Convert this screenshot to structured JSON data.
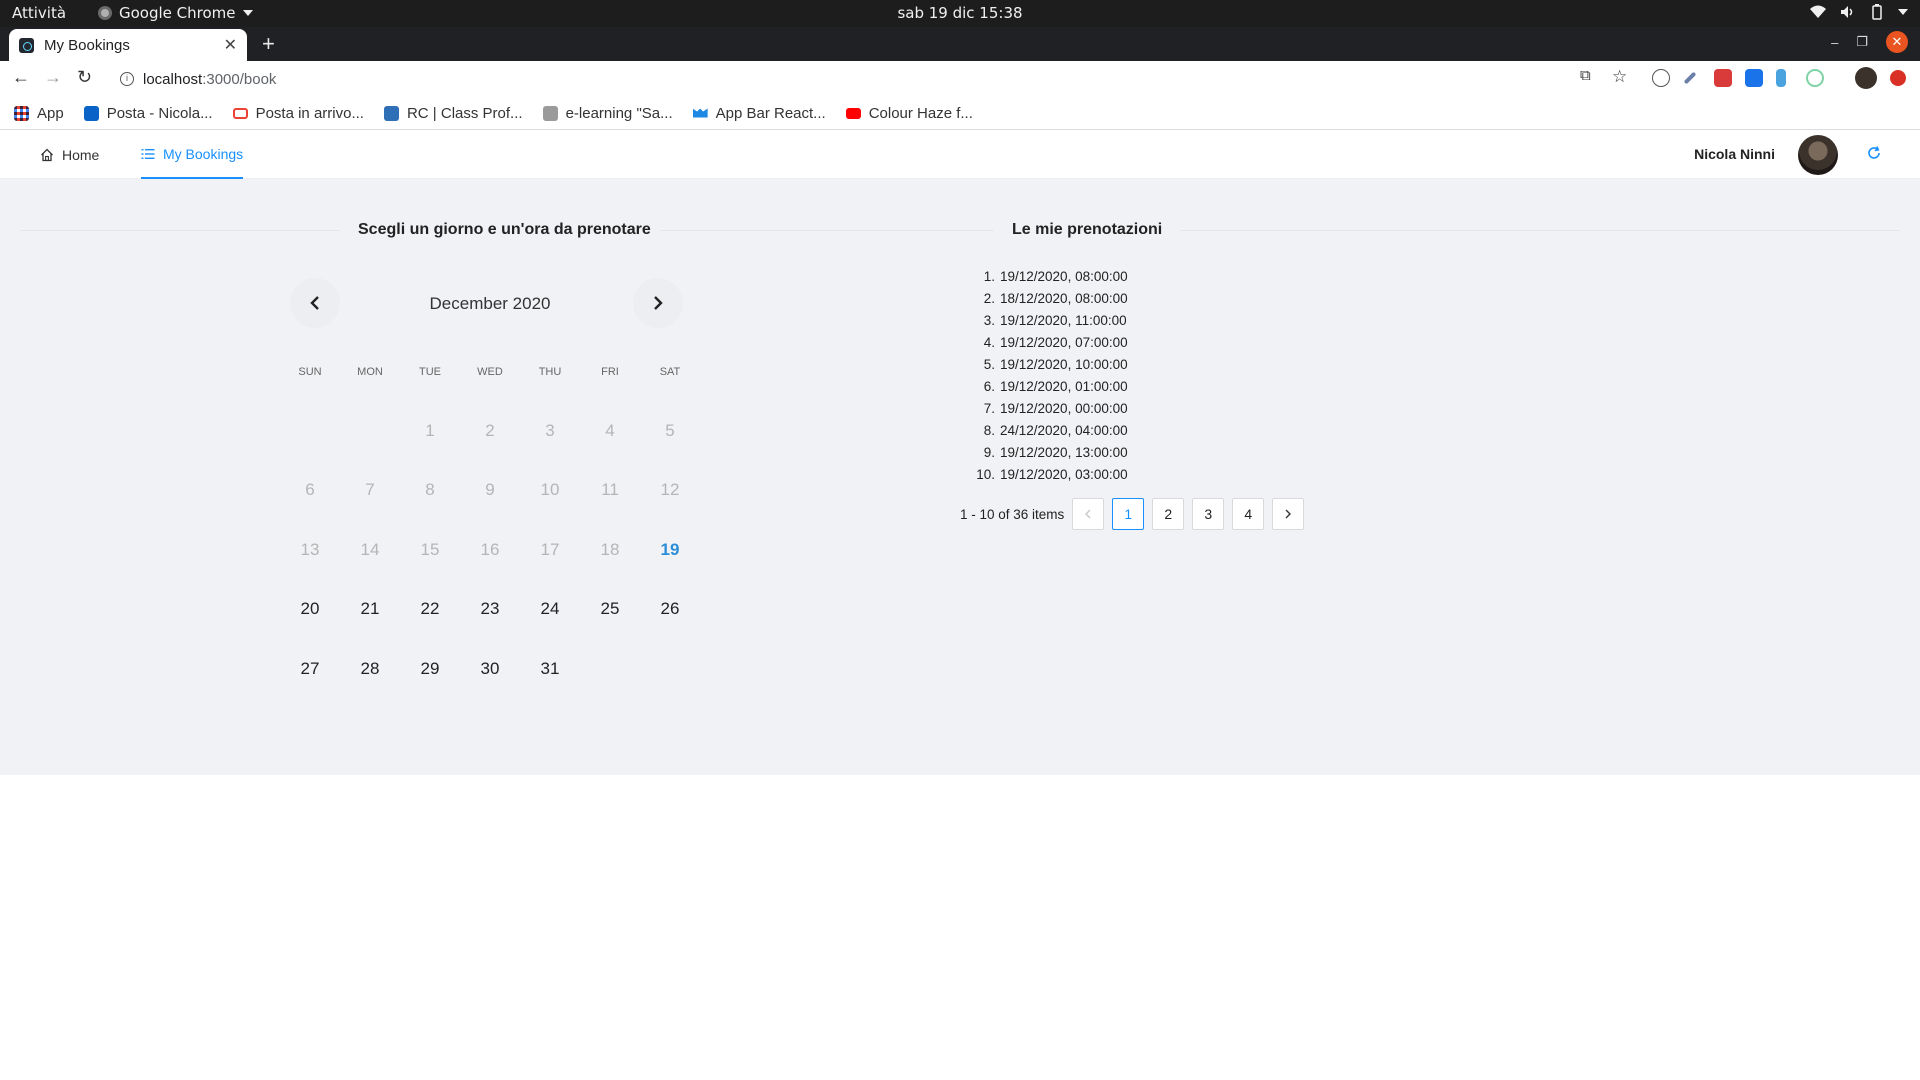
{
  "os": {
    "activities": "Attività",
    "app_name": "Google Chrome",
    "clock": "sab 19 dic  15:38"
  },
  "browser": {
    "tab_title": "My Bookings",
    "url_host": "localhost",
    "url_path": ":3000/book",
    "bookmarks": [
      {
        "label": "App",
        "icon": "apps-grid-icon",
        "color": "#4285f4"
      },
      {
        "label": "Posta - Nicola...",
        "icon": "outlook-icon",
        "color": "#0a64c8"
      },
      {
        "label": "Posta in arrivo...",
        "icon": "gmail-icon",
        "color": "#ea4335"
      },
      {
        "label": "RC | Class Prof...",
        "icon": "p-icon",
        "color": "#2f6fb5"
      },
      {
        "label": "e-learning \"Sa...",
        "icon": "school-icon",
        "color": "#8a8a8a"
      },
      {
        "label": "App Bar React...",
        "icon": "mui-icon",
        "color": "#1e88e5"
      },
      {
        "label": "Colour Haze f...",
        "icon": "youtube-icon",
        "color": "#ff0000"
      }
    ]
  },
  "nav": {
    "items": [
      {
        "label": "Home",
        "icon": "home-icon",
        "active": false
      },
      {
        "label": "My Bookings",
        "icon": "list-icon",
        "active": true
      }
    ],
    "user_name": "Nicola Ninni",
    "accent": "#1890ff"
  },
  "calendar": {
    "section_title": "Scegli un giorno e un'ora da prenotare",
    "month": "December 2020",
    "weekdays": [
      "SUN",
      "MON",
      "TUE",
      "WED",
      "THU",
      "FRI",
      "SAT"
    ],
    "leading_blanks": 2,
    "days": [
      {
        "n": "1",
        "state": "disabled"
      },
      {
        "n": "2",
        "state": "disabled"
      },
      {
        "n": "3",
        "state": "disabled"
      },
      {
        "n": "4",
        "state": "disabled"
      },
      {
        "n": "5",
        "state": "disabled"
      },
      {
        "n": "6",
        "state": "disabled"
      },
      {
        "n": "7",
        "state": "disabled"
      },
      {
        "n": "8",
        "state": "disabled"
      },
      {
        "n": "9",
        "state": "disabled"
      },
      {
        "n": "10",
        "state": "disabled"
      },
      {
        "n": "11",
        "state": "disabled"
      },
      {
        "n": "12",
        "state": "disabled"
      },
      {
        "n": "13",
        "state": "disabled"
      },
      {
        "n": "14",
        "state": "disabled"
      },
      {
        "n": "15",
        "state": "disabled"
      },
      {
        "n": "16",
        "state": "disabled"
      },
      {
        "n": "17",
        "state": "disabled"
      },
      {
        "n": "18",
        "state": "disabled"
      },
      {
        "n": "19",
        "state": "today"
      },
      {
        "n": "20",
        "state": "enabled"
      },
      {
        "n": "21",
        "state": "enabled"
      },
      {
        "n": "22",
        "state": "enabled"
      },
      {
        "n": "23",
        "state": "enabled"
      },
      {
        "n": "24",
        "state": "enabled"
      },
      {
        "n": "25",
        "state": "enabled"
      },
      {
        "n": "26",
        "state": "enabled"
      },
      {
        "n": "27",
        "state": "enabled"
      },
      {
        "n": "28",
        "state": "enabled"
      },
      {
        "n": "29",
        "state": "enabled"
      },
      {
        "n": "30",
        "state": "enabled"
      },
      {
        "n": "31",
        "state": "enabled"
      }
    ],
    "today_color": "#2d8ed8"
  },
  "bookings": {
    "section_title": "Le mie prenotazioni",
    "items": [
      {
        "num": "1.",
        "when": "19/12/2020, 08:00:00"
      },
      {
        "num": "2.",
        "when": "18/12/2020, 08:00:00"
      },
      {
        "num": "3.",
        "when": "19/12/2020, 11:00:00"
      },
      {
        "num": "4.",
        "when": "19/12/2020, 07:00:00"
      },
      {
        "num": "5.",
        "when": "19/12/2020, 10:00:00"
      },
      {
        "num": "6.",
        "when": "19/12/2020, 01:00:00"
      },
      {
        "num": "7.",
        "when": "19/12/2020, 00:00:00"
      },
      {
        "num": "8.",
        "when": "24/12/2020, 04:00:00"
      },
      {
        "num": "9.",
        "when": "19/12/2020, 13:00:00"
      },
      {
        "num": "10.",
        "when": "19/12/2020, 03:00:00"
      }
    ],
    "pagination": {
      "total_text": "1 - 10 of 36 items",
      "pages": [
        "1",
        "2",
        "3",
        "4"
      ],
      "current": "1"
    }
  }
}
